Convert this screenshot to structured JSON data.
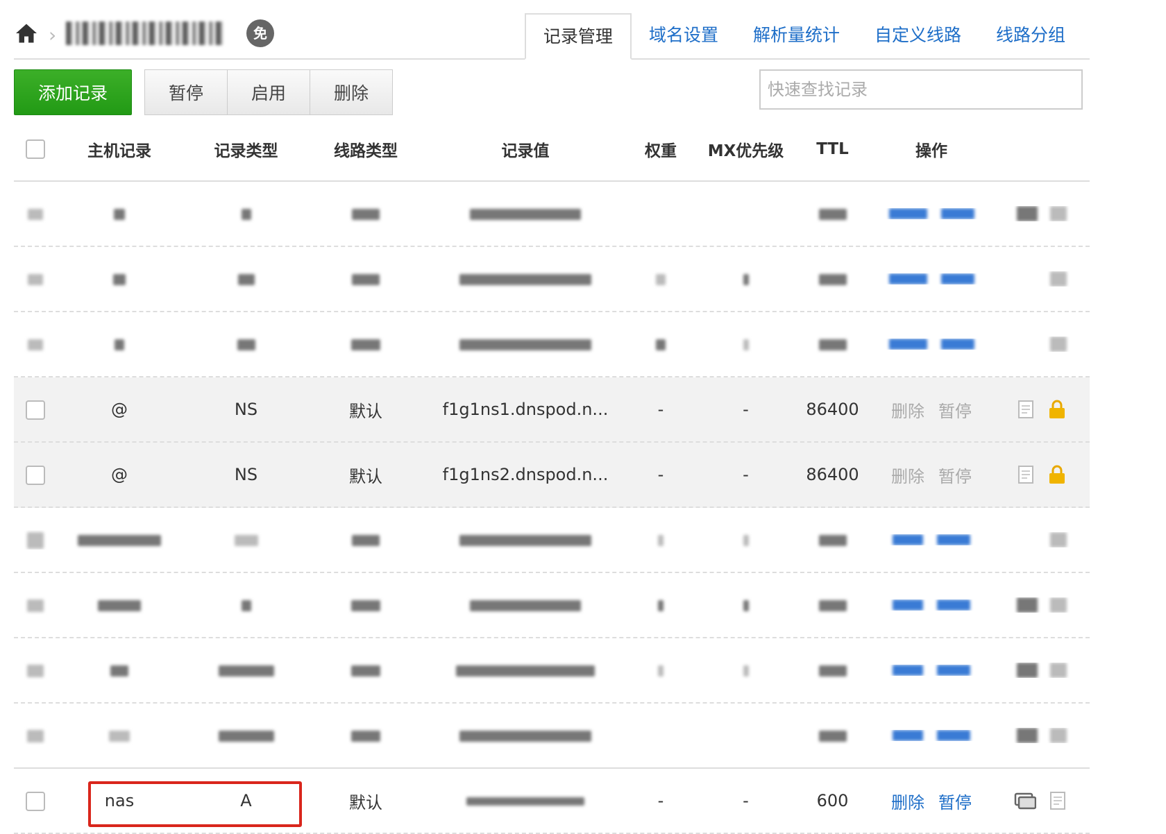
{
  "header": {
    "free_badge": "免",
    "tabs": [
      {
        "label": "记录管理",
        "active": true
      },
      {
        "label": "域名设置"
      },
      {
        "label": "解析量统计"
      },
      {
        "label": "自定义线路"
      },
      {
        "label": "线路分组"
      }
    ]
  },
  "toolbar": {
    "add_label": "添加记录",
    "pause_label": "暂停",
    "enable_label": "启用",
    "delete_label": "删除",
    "search_placeholder": "快速查找记录"
  },
  "table": {
    "columns": [
      "主机记录",
      "记录类型",
      "线路类型",
      "记录值",
      "权重",
      "MX优先级",
      "TTL",
      "操作"
    ],
    "rows": [
      {
        "host": "@",
        "type": "NS",
        "line": "默认",
        "value": "f1g1ns1.dnspod.n...",
        "weight": "-",
        "mx": "-",
        "ttl": "86400",
        "op_delete": "删除",
        "op_pause": "暂停"
      },
      {
        "host": "@",
        "type": "NS",
        "line": "默认",
        "value": "f1g1ns2.dnspod.n...",
        "weight": "-",
        "mx": "-",
        "ttl": "86400",
        "op_delete": "删除",
        "op_pause": "暂停"
      },
      {
        "host": "nas",
        "type": "A",
        "line": "默认",
        "weight": "-",
        "mx": "-",
        "ttl": "600",
        "op_delete": "删除",
        "op_pause": "暂停"
      }
    ]
  },
  "colors": {
    "accent": "#1e6ec8",
    "add_button": "#2aa11c",
    "highlight": "#d9261c",
    "lock": "#f0b400"
  }
}
